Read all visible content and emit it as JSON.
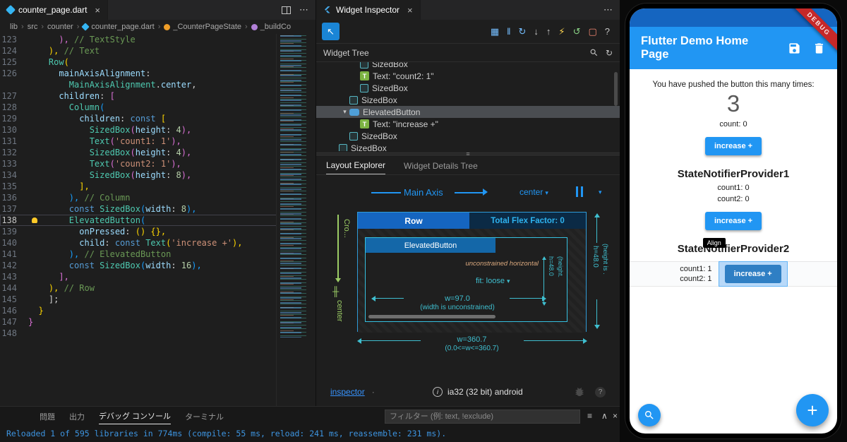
{
  "icons": {
    "close-icon": "×",
    "more-actions-icon": "⋯",
    "breadcrumb-separator": "›",
    "select-widget-cursor-icon": "↖",
    "refresh-icon": "↻",
    "grip-icon": "≡",
    "caret-down-icon": "▾",
    "chevron-down-icon": "▾",
    "text-widget-letter": "T",
    "cross-axis-align-icon": "╫",
    "info-icon": "i",
    "help-icon": "?",
    "filter-icon": "≡",
    "collapse-icon": "∧"
  },
  "editor": {
    "tab": {
      "label": "counter_page.dart"
    },
    "breadcrumb": [
      {
        "label": "lib"
      },
      {
        "label": "src"
      },
      {
        "label": "counter"
      },
      {
        "label": "counter_page.dart",
        "icon": "dart"
      },
      {
        "label": "_CounterPageState",
        "icon": "class"
      },
      {
        "label": "_buildCo",
        "icon": "method"
      }
    ],
    "lines": [
      {
        "n": "123",
        "t": [
          [
            "      ",
            "pn"
          ],
          [
            "),",
            "b2"
          ],
          [
            " // TextStyle",
            "cm"
          ]
        ]
      },
      {
        "n": "124",
        "t": [
          [
            "    ",
            "pn"
          ],
          [
            "),",
            "b1"
          ],
          [
            " // Text",
            "cm"
          ]
        ]
      },
      {
        "n": "125",
        "t": [
          [
            "    ",
            "pn"
          ],
          [
            "Row",
            "cl"
          ],
          [
            "(",
            "b1"
          ]
        ]
      },
      {
        "n": "126",
        "t": [
          [
            "      ",
            "pn"
          ],
          [
            "mainAxisAlignment",
            "pr"
          ],
          [
            ":",
            "pn"
          ]
        ]
      },
      {
        "n": "",
        "t": [
          [
            "        ",
            "pn"
          ],
          [
            "MainAxisAlignment",
            "cl"
          ],
          [
            ".",
            "pn"
          ],
          [
            "center",
            "pr"
          ],
          [
            ",",
            "pn"
          ]
        ]
      },
      {
        "n": "127",
        "t": [
          [
            "      ",
            "pn"
          ],
          [
            "children",
            "pr"
          ],
          [
            ": ",
            "pn"
          ],
          [
            "[",
            "b2"
          ]
        ]
      },
      {
        "n": "128",
        "t": [
          [
            "        ",
            "pn"
          ],
          [
            "Column",
            "cl"
          ],
          [
            "(",
            "b3"
          ]
        ]
      },
      {
        "n": "129",
        "t": [
          [
            "          ",
            "pn"
          ],
          [
            "children",
            "pr"
          ],
          [
            ": ",
            "pn"
          ],
          [
            "const",
            "kw"
          ],
          [
            " ",
            "pn"
          ],
          [
            "[",
            "b1"
          ]
        ]
      },
      {
        "n": "130",
        "t": [
          [
            "            ",
            "pn"
          ],
          [
            "SizedBox",
            "cl"
          ],
          [
            "(",
            "b2"
          ],
          [
            "height",
            "pr"
          ],
          [
            ": ",
            "pn"
          ],
          [
            "4",
            "nu"
          ],
          [
            "),",
            "b2"
          ]
        ]
      },
      {
        "n": "131",
        "t": [
          [
            "            ",
            "pn"
          ],
          [
            "Text",
            "cl"
          ],
          [
            "(",
            "b2"
          ],
          [
            "'count1: 1'",
            "st"
          ],
          [
            "),",
            "b2"
          ]
        ]
      },
      {
        "n": "132",
        "t": [
          [
            "            ",
            "pn"
          ],
          [
            "SizedBox",
            "cl"
          ],
          [
            "(",
            "b2"
          ],
          [
            "height",
            "pr"
          ],
          [
            ": ",
            "pn"
          ],
          [
            "4",
            "nu"
          ],
          [
            "),",
            "b2"
          ]
        ]
      },
      {
        "n": "133",
        "t": [
          [
            "            ",
            "pn"
          ],
          [
            "Text",
            "cl"
          ],
          [
            "(",
            "b2"
          ],
          [
            "'count2: 1'",
            "st"
          ],
          [
            "),",
            "b2"
          ]
        ]
      },
      {
        "n": "134",
        "t": [
          [
            "            ",
            "pn"
          ],
          [
            "SizedBox",
            "cl"
          ],
          [
            "(",
            "b2"
          ],
          [
            "height",
            "pr"
          ],
          [
            ": ",
            "pn"
          ],
          [
            "8",
            "nu"
          ],
          [
            "),",
            "b2"
          ]
        ]
      },
      {
        "n": "135",
        "t": [
          [
            "          ",
            "pn"
          ],
          [
            "],",
            "b1"
          ]
        ]
      },
      {
        "n": "136",
        "t": [
          [
            "        ",
            "pn"
          ],
          [
            "),",
            "b3"
          ],
          [
            " // Column",
            "cm"
          ]
        ]
      },
      {
        "n": "137",
        "t": [
          [
            "        ",
            "pn"
          ],
          [
            "const",
            "kw"
          ],
          [
            " ",
            "pn"
          ],
          [
            "SizedBox",
            "cl"
          ],
          [
            "(",
            "b3"
          ],
          [
            "width",
            "pr"
          ],
          [
            ": ",
            "pn"
          ],
          [
            "8",
            "nu"
          ],
          [
            "),",
            "b3"
          ]
        ]
      },
      {
        "n": "138",
        "bulb": true,
        "active": true,
        "t": [
          [
            "        ",
            "pn"
          ],
          [
            "ElevatedButton",
            "cl"
          ],
          [
            "(",
            "b3"
          ]
        ]
      },
      {
        "n": "139",
        "t": [
          [
            "          ",
            "pn"
          ],
          [
            "onPressed",
            "pr"
          ],
          [
            ": ",
            "pn"
          ],
          [
            "()",
            "b1"
          ],
          [
            " ",
            "pn"
          ],
          [
            "{},",
            "b1"
          ]
        ]
      },
      {
        "n": "140",
        "t": [
          [
            "          ",
            "pn"
          ],
          [
            "child",
            "pr"
          ],
          [
            ": ",
            "pn"
          ],
          [
            "const",
            "kw"
          ],
          [
            " ",
            "pn"
          ],
          [
            "Text",
            "cl"
          ],
          [
            "(",
            "b1"
          ],
          [
            "'increase +'",
            "st"
          ],
          [
            "),",
            "b1"
          ]
        ]
      },
      {
        "n": "141",
        "t": [
          [
            "        ",
            "pn"
          ],
          [
            "),",
            "b3"
          ],
          [
            " // ElevatedButton",
            "cm"
          ]
        ]
      },
      {
        "n": "142",
        "t": [
          [
            "        ",
            "pn"
          ],
          [
            "const",
            "kw"
          ],
          [
            " ",
            "pn"
          ],
          [
            "SizedBox",
            "cl"
          ],
          [
            "(",
            "b3"
          ],
          [
            "width",
            "pr"
          ],
          [
            ": ",
            "pn"
          ],
          [
            "16",
            "nu"
          ],
          [
            "),",
            "b3"
          ]
        ]
      },
      {
        "n": "143",
        "t": [
          [
            "      ",
            "pn"
          ],
          [
            "],",
            "b2"
          ]
        ]
      },
      {
        "n": "144",
        "t": [
          [
            "    ",
            "pn"
          ],
          [
            "),",
            "b1"
          ],
          [
            " // Row",
            "cm"
          ]
        ]
      },
      {
        "n": "145",
        "t": [
          [
            "    ",
            "pn"
          ],
          [
            "];",
            "pn"
          ]
        ]
      },
      {
        "n": "146",
        "t": [
          [
            "  ",
            "pn"
          ],
          [
            "}",
            "b1"
          ]
        ]
      },
      {
        "n": "147",
        "t": [
          [
            "}",
            "b2"
          ]
        ]
      },
      {
        "n": "148",
        "t": []
      }
    ]
  },
  "inspector": {
    "tab": {
      "label": "Widget Inspector"
    },
    "toolbar_icons": [
      {
        "name": "layout-grid-icon",
        "glyph": "▦",
        "color": "#75BEFF"
      },
      {
        "name": "pause-icon",
        "glyph": "‖",
        "color": "#75BEFF"
      },
      {
        "name": "step-over-icon",
        "glyph": "↻",
        "color": "#75BEFF"
      },
      {
        "name": "step-into-icon",
        "glyph": "↓",
        "color": "#c5c5c5"
      },
      {
        "name": "step-out-icon",
        "glyph": "↑",
        "color": "#c5c5c5"
      },
      {
        "name": "hot-reload-icon",
        "glyph": "⚡",
        "color": "#FFD54F"
      },
      {
        "name": "hot-restart-icon",
        "glyph": "↺",
        "color": "#89D185"
      },
      {
        "name": "stop-icon",
        "glyph": "▢",
        "color": "#F48771"
      },
      {
        "name": "help-icon",
        "glyph": "?",
        "color": "#c5c5c5"
      }
    ],
    "tree": {
      "title": "Widget Tree",
      "items": [
        {
          "label": "SizedBox",
          "type": "box",
          "indent": 3
        },
        {
          "label": "Text: \"count2: 1\"",
          "type": "text",
          "indent": 3
        },
        {
          "label": "SizedBox",
          "type": "box",
          "indent": 3
        },
        {
          "label": "SizedBox",
          "type": "box",
          "indent": 2
        },
        {
          "label": "ElevatedButton",
          "type": "button",
          "indent": 2,
          "selected": true,
          "expanded": true
        },
        {
          "label": "Text: \"increase +\"",
          "type": "text",
          "indent": 3
        },
        {
          "label": "SizedBox",
          "type": "box",
          "indent": 2
        },
        {
          "label": "SizedBox",
          "type": "box",
          "indent": 1
        }
      ]
    },
    "tabs": {
      "layout_explorer": "Layout Explorer",
      "details_tree": "Widget Details Tree"
    },
    "layout": {
      "main_axis_label": "Main Axis",
      "main_axis_alignment": "center",
      "cross_axis_label": "Cro...",
      "cross_axis_alignment": "center",
      "row_label": "Row",
      "flex_label": "Total Flex Factor: 0",
      "child_label": "ElevatedButton",
      "unconstrained": "unconstrained horizontal",
      "fit": "fit: loose",
      "child_width": "w=97.0",
      "child_width_note": "(width is unconstrained)",
      "child_height": "h=48.0",
      "child_height_note": "(height.",
      "row_height": "h=48.0",
      "row_height_note": "(height is .",
      "row_width": "w=360.7",
      "row_width_note": "(0.0<=w<=360.7)"
    },
    "statusbar": {
      "link": "inspector",
      "sep": "·",
      "device": "ia32 (32 bit) android"
    }
  },
  "phone": {
    "appbar": {
      "title": "Flutter Demo Home Page"
    },
    "debug_banner": "DEBUG",
    "body": {
      "push_text": "You have pushed the button this many times:",
      "counter": "3",
      "count": "count: 0",
      "btn1": "increase +",
      "provider1": {
        "title": "StateNotifierProvider1",
        "count1": "count1: 0",
        "count2": "count2: 0",
        "btn": "increase +"
      },
      "provider2": {
        "title": "StateNotifierProvider2",
        "count1": "count1: 1",
        "count2": "count2: 1",
        "btn": "increase +",
        "tooltip": "Align"
      }
    },
    "fab_plus": "+"
  },
  "panel": {
    "tabs": [
      {
        "label": "問題"
      },
      {
        "label": "出力"
      },
      {
        "label": "デバッグ コンソール",
        "active": true
      },
      {
        "label": "ターミナル"
      }
    ],
    "filter_placeholder": "フィルター (例: text, !exclude)",
    "console_line": "Reloaded 1 of 595 libraries in 774ms (compile: 55 ms, reload: 241 ms, reassemble: 231 ms)."
  }
}
